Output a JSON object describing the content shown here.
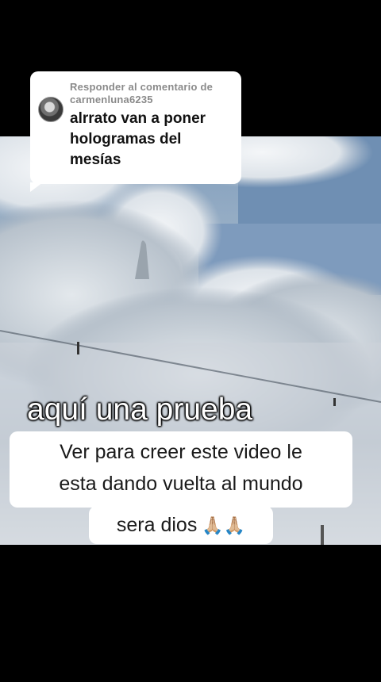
{
  "reply": {
    "header_line1": "Responder al comentario de",
    "header_line2": "carmenluna6235",
    "text": "alrrato van a poner hologramas del mesías"
  },
  "overlay_caption": "aquí una prueba",
  "caption": {
    "line1": "Ver para creer este video le",
    "line2": "esta dando vuelta al mundo",
    "line3": "sera dios",
    "emoji": "🙏🏼🙏🏼"
  },
  "colors": {
    "sky": "#7f9cbb",
    "cloud": "#e9edf1",
    "bubble": "#ffffff",
    "header_text": "#8a8a8a"
  }
}
